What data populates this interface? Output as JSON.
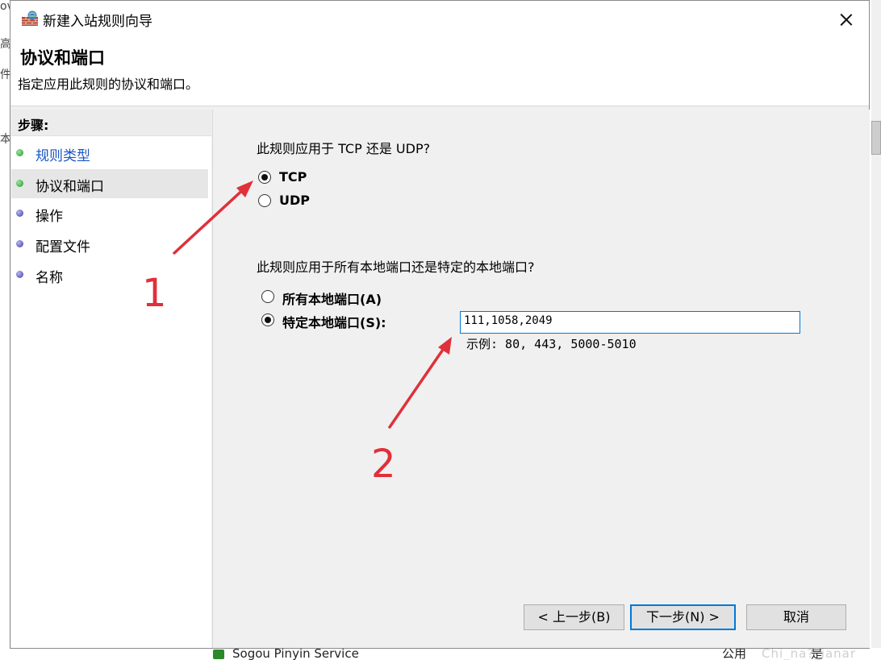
{
  "dialog": {
    "title": "新建入站规则向导",
    "page_title": "协议和端口",
    "page_desc": "指定应用此规则的协议和端口。"
  },
  "steps": {
    "header": "步骤:",
    "items": [
      {
        "label": "规则类型",
        "state": "done"
      },
      {
        "label": "协议和端口",
        "state": "current"
      },
      {
        "label": "操作",
        "state": "pending"
      },
      {
        "label": "配置文件",
        "state": "pending"
      },
      {
        "label": "名称",
        "state": "pending"
      }
    ]
  },
  "protocol": {
    "question": "此规则应用于 TCP 还是 UDP?",
    "options": [
      {
        "label": "TCP",
        "checked": true
      },
      {
        "label": "UDP",
        "checked": false
      }
    ]
  },
  "ports": {
    "question": "此规则应用于所有本地端口还是特定的本地端口?",
    "options": [
      {
        "label": "所有本地端口(A)",
        "checked": false
      },
      {
        "label": "特定本地端口(S):",
        "checked": true
      }
    ],
    "value": "111,1058,2049",
    "example": "示例: 80, 443, 5000-5010"
  },
  "buttons": {
    "back": "< 上一步(B)",
    "next": "下一步(N) >",
    "cancel": "取消"
  },
  "annotations": {
    "one": "1",
    "two": "2",
    "color": "#e0303a"
  },
  "background": {
    "service_label": "Sogou Pinyin Service",
    "profile": "公用",
    "enabled": "是",
    "watermark": "Chi_na?_ianar",
    "frag_ov": "ov",
    "frag_gao": "高",
    "frag_jian": "件",
    "frag_ben": "本"
  }
}
